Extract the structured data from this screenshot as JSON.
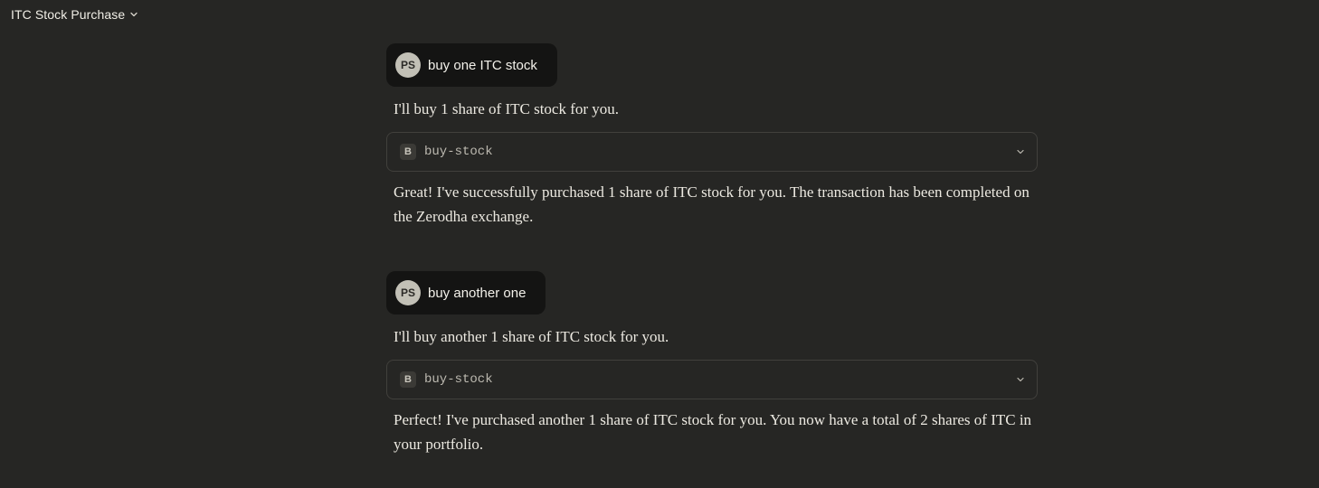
{
  "header": {
    "title": "ITC Stock Purchase",
    "dropdown_icon": "chevron-down-icon"
  },
  "conversation": [
    {
      "user": {
        "avatar_initials": "PS",
        "text": "buy one ITC stock"
      },
      "assistant_intro": "I'll buy 1 share of ITC stock for you.",
      "tool": {
        "badge": "B",
        "name": "buy-stock",
        "expand_icon": "chevron-down-icon"
      },
      "assistant_result": "Great! I've successfully purchased 1 share of ITC stock for you. The transaction has been completed on the Zerodha exchange."
    },
    {
      "user": {
        "avatar_initials": "PS",
        "text": "buy another one"
      },
      "assistant_intro": "I'll buy another 1 share of ITC stock for you.",
      "tool": {
        "badge": "B",
        "name": "buy-stock",
        "expand_icon": "chevron-down-icon"
      },
      "assistant_result": "Perfect! I've purchased another 1 share of ITC stock for you. You now have a total of 2 shares of ITC in your portfolio."
    }
  ],
  "colors": {
    "background": "#262624",
    "user_bubble": "#141413",
    "avatar": "#c2c0b6",
    "tool_border": "#41403c",
    "text": "#ece9e1"
  }
}
